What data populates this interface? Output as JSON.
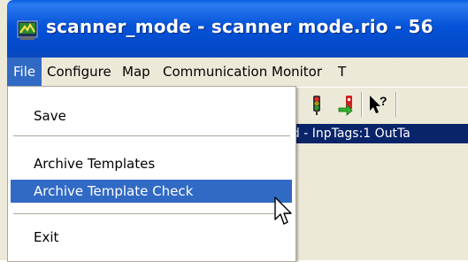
{
  "window": {
    "title": "scanner_mode - scanner mode.rio - 56",
    "app_icon": "scanner-app-icon",
    "title_color": "#ffffff",
    "title_bar_color": "#0553d8"
  },
  "menubar": {
    "items": [
      {
        "label": "File"
      },
      {
        "label": "Configure"
      },
      {
        "label": "Map"
      },
      {
        "label": "Communication"
      },
      {
        "label": "Monitor"
      },
      {
        "label": "T"
      }
    ]
  },
  "toolbar": {
    "icons": [
      "traffic-light-icon",
      "download-tag-icon",
      "help-pointer-icon"
    ]
  },
  "infobar": {
    "text": "ud - InpTags:1 OutTa"
  },
  "file_menu": {
    "items": [
      {
        "label": "Save"
      },
      {
        "label": "Archive Templates"
      },
      {
        "label": "Archive Template Check"
      },
      {
        "label": "Exit"
      }
    ],
    "highlight_color": "#316ac5"
  },
  "cursor": {
    "icon": "mouse-pointer-icon"
  }
}
